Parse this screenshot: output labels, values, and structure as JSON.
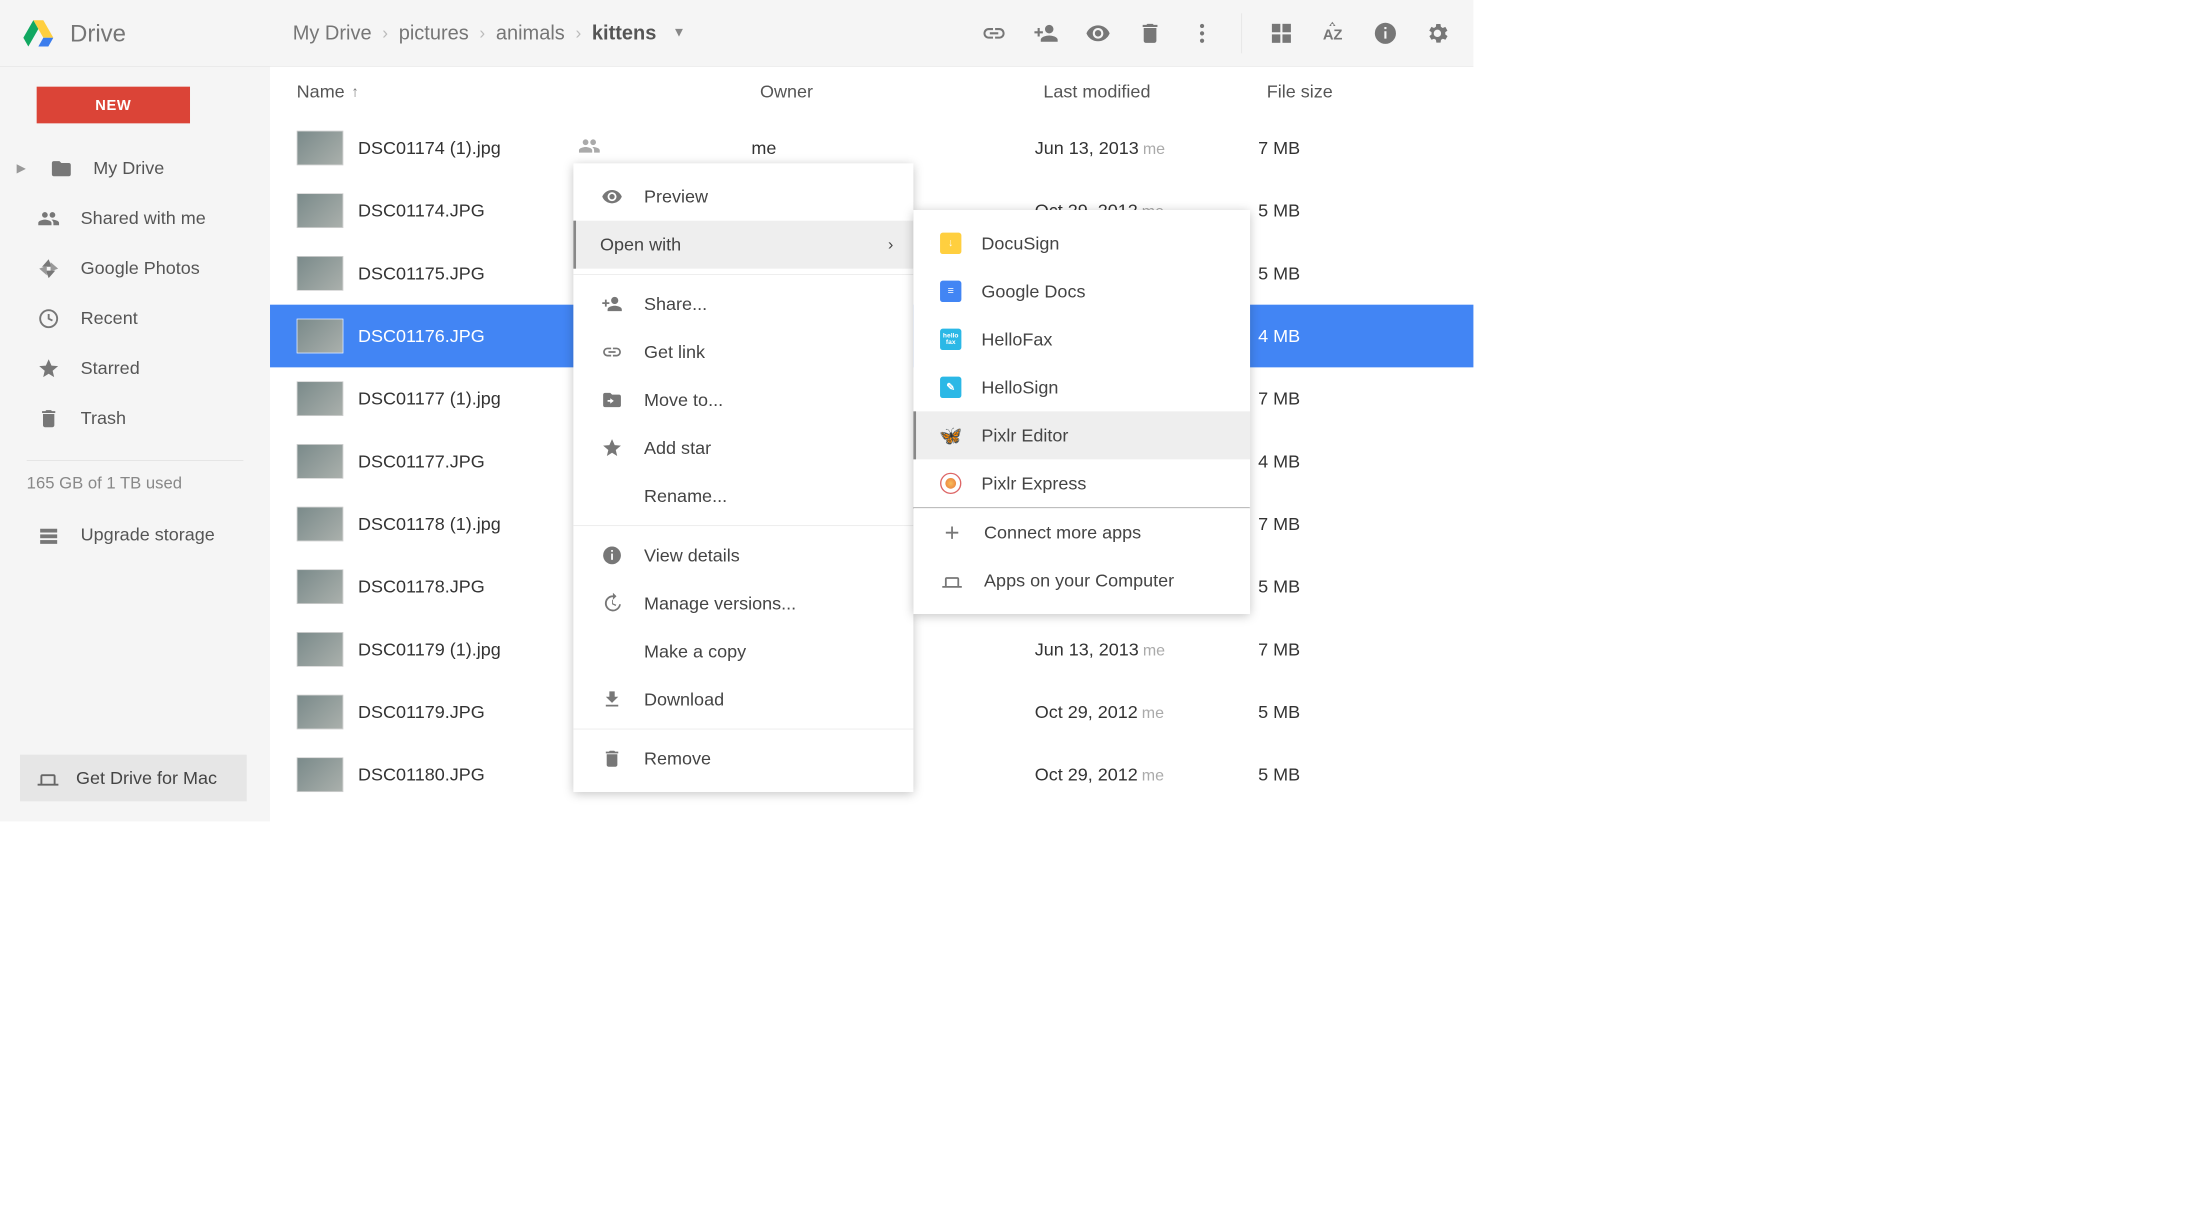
{
  "app": {
    "title": "Drive"
  },
  "breadcrumbs": [
    "My Drive",
    "pictures",
    "animals",
    "kittens"
  ],
  "sidebar": {
    "new_label": "NEW",
    "items": [
      {
        "label": "My Drive"
      },
      {
        "label": "Shared with me"
      },
      {
        "label": "Google Photos"
      },
      {
        "label": "Recent"
      },
      {
        "label": "Starred"
      },
      {
        "label": "Trash"
      }
    ],
    "storage_text": "165 GB of 1 TB used",
    "upgrade_label": "Upgrade storage",
    "get_drive_label": "Get Drive for Mac"
  },
  "columns": {
    "name": "Name",
    "owner": "Owner",
    "modified": "Last modified",
    "size": "File size"
  },
  "files": [
    {
      "name": "DSC01174 (1).jpg",
      "owner": "me",
      "modified": "Jun 13, 2013",
      "modified_by": "me",
      "size": "7 MB",
      "selected": false
    },
    {
      "name": "DSC01174.JPG",
      "owner": "",
      "modified": "Oct 29, 2012",
      "modified_by": "me",
      "size": "5 MB",
      "selected": false
    },
    {
      "name": "DSC01175.JPG",
      "owner": "",
      "modified": "",
      "modified_by": "",
      "size": "5 MB",
      "selected": false
    },
    {
      "name": "DSC01176.JPG",
      "owner": "",
      "modified": "",
      "modified_by": "",
      "size": "4 MB",
      "selected": true
    },
    {
      "name": "DSC01177 (1).jpg",
      "owner": "",
      "modified": "",
      "modified_by": "",
      "size": "7 MB",
      "selected": false
    },
    {
      "name": "DSC01177.JPG",
      "owner": "",
      "modified": "",
      "modified_by": "",
      "size": "4 MB",
      "selected": false
    },
    {
      "name": "DSC01178 (1).jpg",
      "owner": "",
      "modified": "",
      "modified_by": "",
      "size": "7 MB",
      "selected": false
    },
    {
      "name": "DSC01178.JPG",
      "owner": "",
      "modified": "",
      "modified_by": "",
      "size": "5 MB",
      "selected": false
    },
    {
      "name": "DSC01179 (1).jpg",
      "owner": "",
      "modified": "Jun 13, 2013",
      "modified_by": "me",
      "size": "7 MB",
      "selected": false
    },
    {
      "name": "DSC01179.JPG",
      "owner": "",
      "modified": "Oct 29, 2012",
      "modified_by": "me",
      "size": "5 MB",
      "selected": false
    },
    {
      "name": "DSC01180.JPG",
      "owner": "",
      "modified": "Oct 29, 2012",
      "modified_by": "me",
      "size": "5 MB",
      "selected": false
    }
  ],
  "context_menu": {
    "preview": "Preview",
    "open_with": "Open with",
    "share": "Share...",
    "get_link": "Get link",
    "move_to": "Move to...",
    "add_star": "Add star",
    "rename": "Rename...",
    "view_details": "View details",
    "manage_versions": "Manage versions...",
    "make_copy": "Make a copy",
    "download": "Download",
    "remove": "Remove"
  },
  "open_with_apps": [
    {
      "label": "DocuSign"
    },
    {
      "label": "Google Docs"
    },
    {
      "label": "HelloFax"
    },
    {
      "label": "HelloSign"
    },
    {
      "label": "Pixlr Editor"
    },
    {
      "label": "Pixlr Express"
    }
  ],
  "open_with_more": {
    "connect": "Connect more apps",
    "on_computer": "Apps on your Computer"
  }
}
